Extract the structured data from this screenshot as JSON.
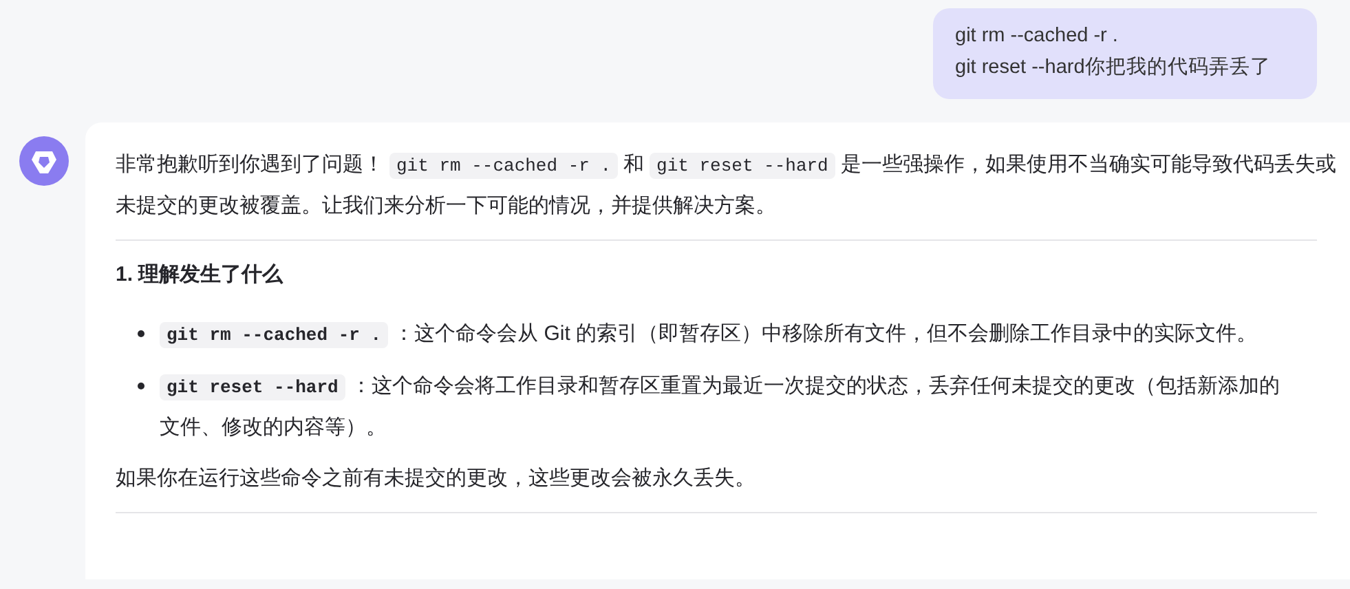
{
  "user_message": {
    "lines": [
      "git rm --cached -r .",
      "git reset --hard你把我的代码弄丢了"
    ]
  },
  "assistant_message": {
    "blocks": [
      {
        "kind": "paragraph",
        "segments": [
          {
            "kind": "text",
            "text": "非常抱歉听到你遇到了问题！"
          },
          {
            "kind": "code",
            "text": "git rm --cached -r ."
          },
          {
            "kind": "text",
            "text": "和"
          },
          {
            "kind": "code",
            "text": "git reset --hard"
          },
          {
            "kind": "text",
            "text": "是一些强操作，如果使用不当确实可能导致代码丢失或未提交的更改被覆盖。让我们来分析一下可能的情况，并提供解决方案。"
          }
        ]
      },
      {
        "kind": "divider"
      },
      {
        "kind": "heading",
        "text": "1. 理解发生了什么"
      },
      {
        "kind": "bullets",
        "items": [
          [
            {
              "kind": "code",
              "text": "git rm --cached -r ."
            },
            {
              "kind": "text",
              "text": "：这个命令会从 Git 的索引（即暂存区）中移除所有文件，但不会删除工作目录中的实际文件。"
            }
          ],
          [
            {
              "kind": "code",
              "text": "git reset --hard"
            },
            {
              "kind": "text",
              "text": "：这个命令会将工作目录和暂存区重置为最近一次提交的状态，丢弃任何未提交的更改（包括新添加的文件、修改的内容等）。"
            }
          ]
        ]
      },
      {
        "kind": "paragraph",
        "segments": [
          {
            "kind": "text",
            "text": "如果你在运行这些命令之前有未提交的更改，这些更改会被永久丢失。"
          }
        ]
      },
      {
        "kind": "divider"
      }
    ]
  }
}
